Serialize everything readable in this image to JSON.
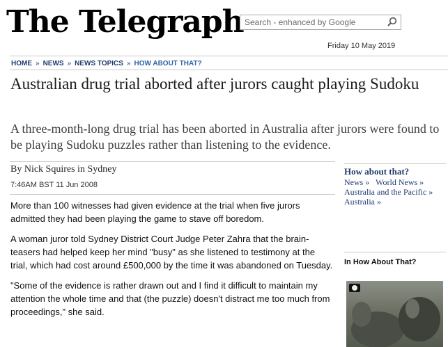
{
  "masthead": "The Telegraph",
  "search": {
    "placeholder": "Search - enhanced by Google"
  },
  "date": "Friday 10 May 2019",
  "breadcrumb": {
    "items": [
      "HOME",
      "NEWS",
      "NEWS TOPICS"
    ],
    "separator": "»",
    "current": "HOW ABOUT THAT?"
  },
  "article": {
    "headline": "Australian drug trial aborted after jurors caught playing Sudoku",
    "standfirst": "A three-month-long drug trial has been aborted in Australia after jurors were found to be playing Sudoku puzzles rather than listening to the evidence.",
    "byline": "By Nick Squires in Sydney",
    "timestamp": "7:46AM BST 11 Jun 2008",
    "paragraphs": [
      "More than 100 witnesses had given evidence at the trial when five jurors admitted they had been playing the game to stave off boredom.",
      "A woman juror told Sydney District Court Judge Peter Zahra that the brain-teasers had helped keep her mind \"busy\" as she listened to testimony at the trial, which had cost around £500,000 by the time it was abandoned on Tuesday.",
      "\"Some of the evidence is rather drawn out and I find it difficult to maintain my attention the whole time and that (the puzzle) doesn't distract me too much from proceedings,\" she said."
    ]
  },
  "sidebar": {
    "title": "How about that?",
    "links": [
      "News »",
      "World News »",
      "Australia and the Pacific »",
      "Australia »"
    ],
    "section2_title": "In How About That?"
  },
  "colors": {
    "link_navy": "#1f3b70",
    "current_blue": "#2f64a3"
  }
}
